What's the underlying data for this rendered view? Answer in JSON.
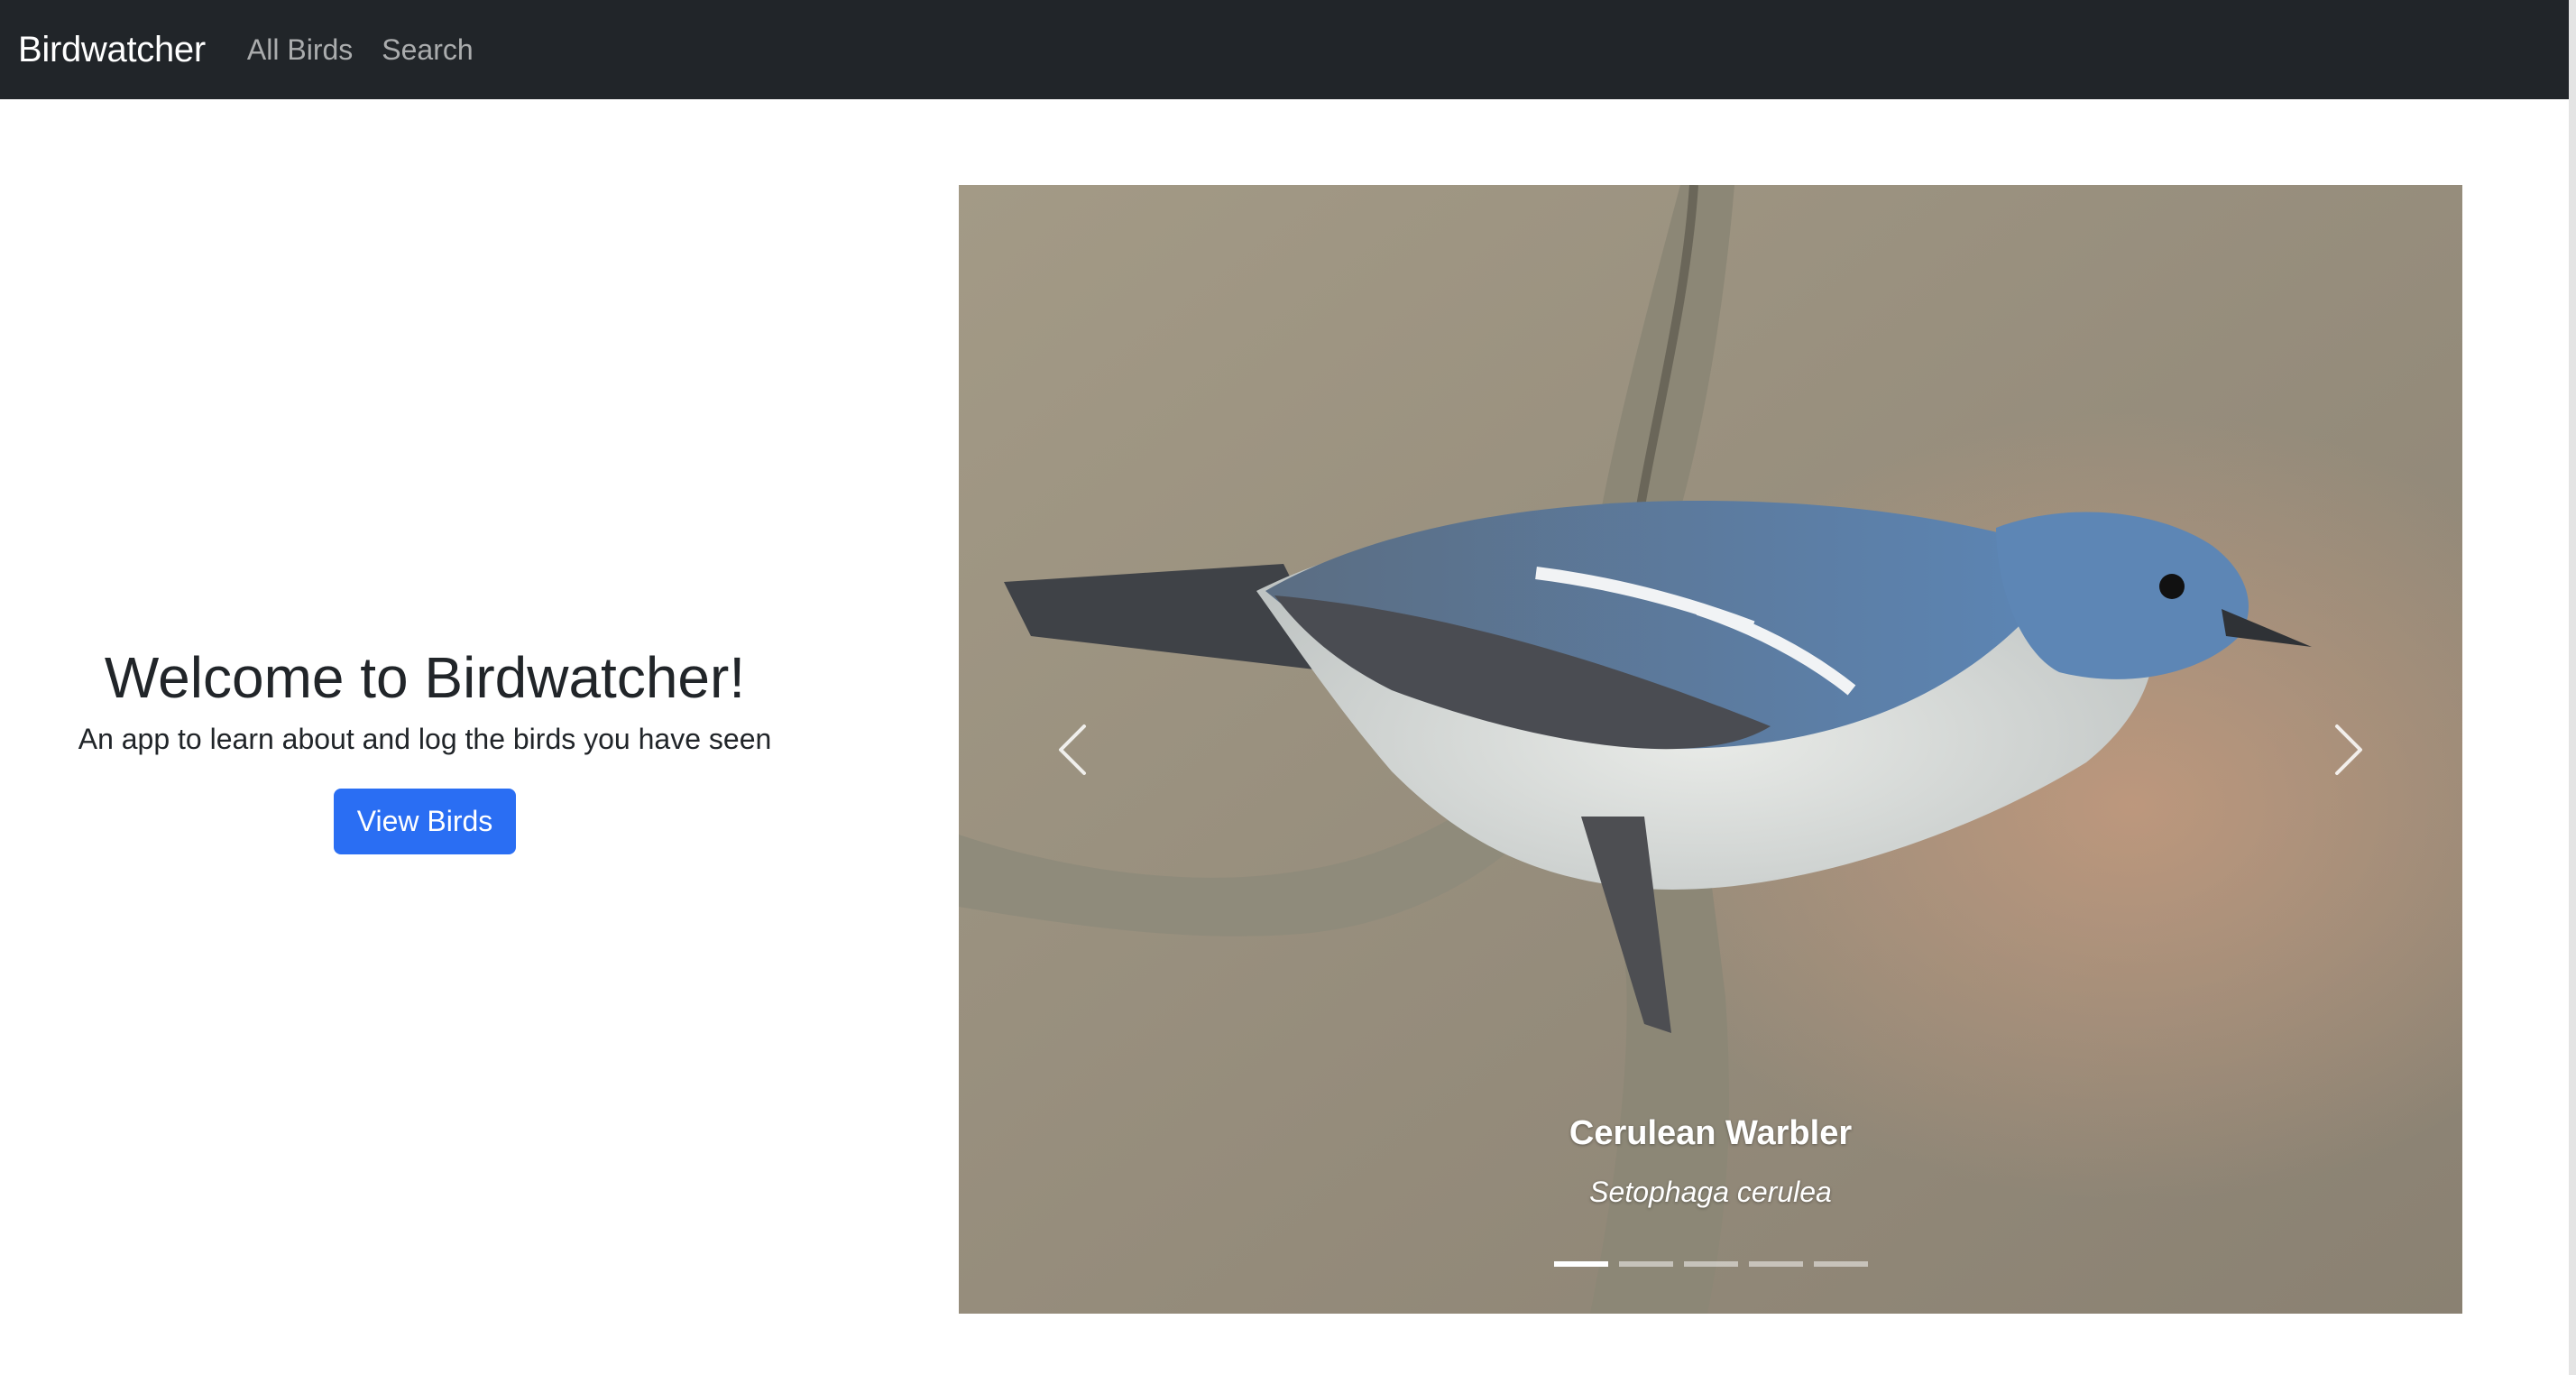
{
  "navbar": {
    "brand": "Birdwatcher",
    "links": [
      "All Birds",
      "Search"
    ]
  },
  "hero": {
    "title": "Welcome to Birdwatcher!",
    "subtitle": "An app to learn about and log the birds you have seen",
    "button_label": "View Birds"
  },
  "carousel": {
    "slide_name": "Cerulean Warbler",
    "slide_scientific_name": "Setophaga cerulea",
    "indicator_count": 5,
    "active_indicator": 0,
    "prev_icon": "chevron-left-icon",
    "next_icon": "chevron-right-icon"
  },
  "colors": {
    "navbar_bg": "#212529",
    "primary": "#2a6ef3"
  }
}
